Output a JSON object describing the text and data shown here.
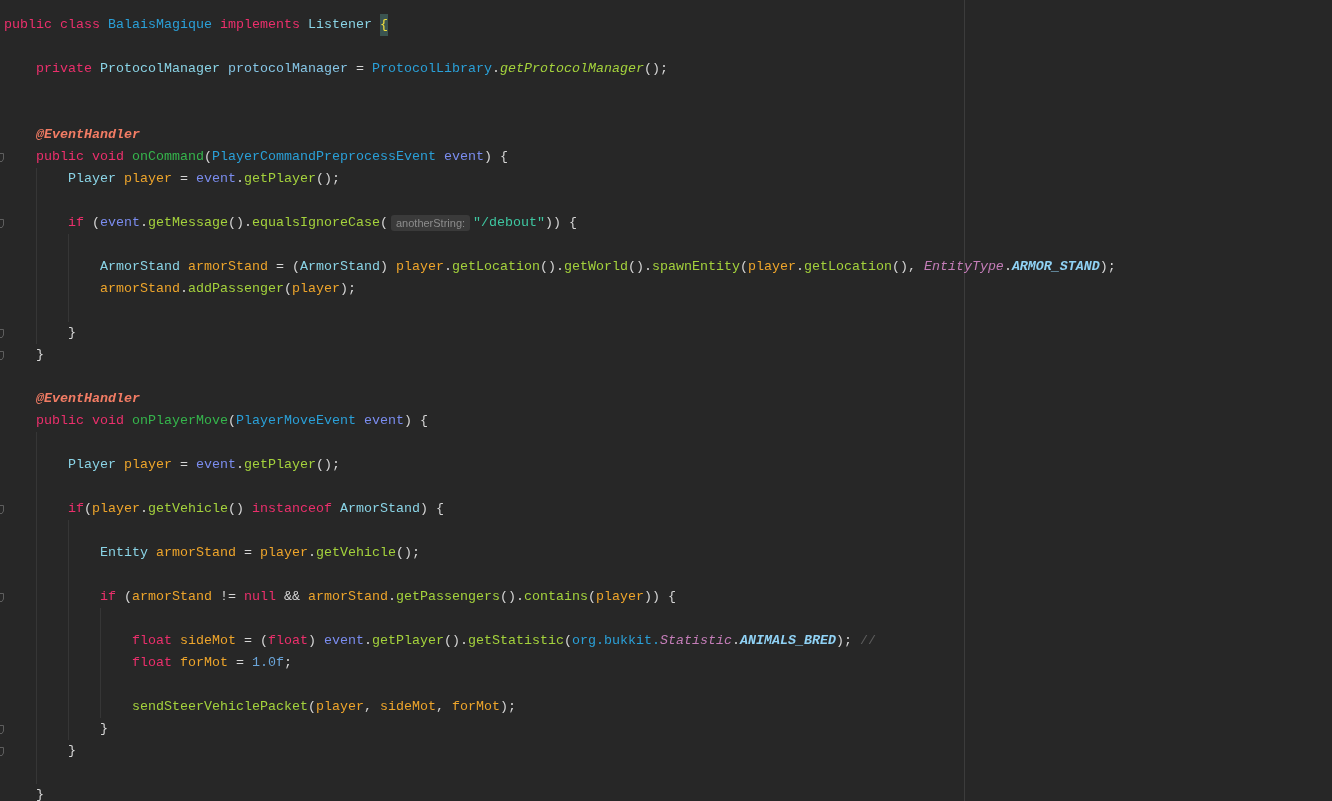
{
  "editor": {
    "lines": [
      {
        "kind": "code",
        "fold": false,
        "tokens": [
          {
            "text": "public ",
            "kind": "keyword"
          },
          {
            "text": "class ",
            "kind": "keyword"
          },
          {
            "text": "BalaisMagique ",
            "kind": "class"
          },
          {
            "text": "implements ",
            "kind": "keyword"
          },
          {
            "text": "Listener ",
            "kind": "type"
          },
          {
            "text": "{",
            "kind": "brace"
          }
        ]
      },
      {
        "kind": "blank",
        "fold": false
      },
      {
        "kind": "code",
        "fold": false,
        "tokens": [
          {
            "text": "    private ",
            "kind": "keyword"
          },
          {
            "text": "ProtocolManager ",
            "kind": "type"
          },
          {
            "text": "protocolManager",
            "kind": "field"
          },
          {
            "text": " = ",
            "kind": "plain"
          },
          {
            "text": "ProtocolLibrary",
            "kind": "class"
          },
          {
            "text": ".",
            "kind": "plain"
          },
          {
            "text": "getProtocolManager",
            "kind": "static"
          },
          {
            "text": "();",
            "kind": "plain"
          }
        ]
      },
      {
        "kind": "blank",
        "fold": false
      },
      {
        "kind": "blank",
        "fold": false
      },
      {
        "kind": "code",
        "fold": false,
        "tokens": [
          {
            "text": "    @EventHandler",
            "kind": "annotation"
          }
        ]
      },
      {
        "kind": "code",
        "fold": true,
        "tokens": [
          {
            "text": "    public ",
            "kind": "keyword"
          },
          {
            "text": "void ",
            "kind": "keyword"
          },
          {
            "text": "onCommand",
            "kind": "declaration"
          },
          {
            "text": "(",
            "kind": "plain"
          },
          {
            "text": "PlayerCommandPreprocessEvent ",
            "kind": "class"
          },
          {
            "text": "event",
            "kind": "parameter"
          },
          {
            "text": ") {",
            "kind": "plain"
          }
        ]
      },
      {
        "kind": "code",
        "fold": false,
        "tokens": [
          {
            "text": "        Player ",
            "kind": "type"
          },
          {
            "text": "player",
            "kind": "local"
          },
          {
            "text": " = ",
            "kind": "plain"
          },
          {
            "text": "event",
            "kind": "parameter"
          },
          {
            "text": ".",
            "kind": "plain"
          },
          {
            "text": "getPlayer",
            "kind": "call"
          },
          {
            "text": "();",
            "kind": "plain"
          }
        ]
      },
      {
        "kind": "blank",
        "fold": false
      },
      {
        "kind": "code",
        "fold": true,
        "tokens": [
          {
            "text": "        if",
            "kind": "keyword"
          },
          {
            "text": " (",
            "kind": "plain"
          },
          {
            "text": "event",
            "kind": "parameter"
          },
          {
            "text": ".",
            "kind": "plain"
          },
          {
            "text": "getMessage",
            "kind": "call"
          },
          {
            "text": "().",
            "kind": "plain"
          },
          {
            "text": "equalsIgnoreCase",
            "kind": "call"
          },
          {
            "text": "(",
            "kind": "plain"
          },
          {
            "text": "anotherString:",
            "kind": "hint"
          },
          {
            "text": "\"/debout\"",
            "kind": "string"
          },
          {
            "text": ")) {",
            "kind": "plain"
          }
        ]
      },
      {
        "kind": "blank",
        "fold": false
      },
      {
        "kind": "code",
        "fold": false,
        "tokens": [
          {
            "text": "            ArmorStand ",
            "kind": "type"
          },
          {
            "text": "armorStand",
            "kind": "local"
          },
          {
            "text": " = (",
            "kind": "plain"
          },
          {
            "text": "ArmorStand",
            "kind": "type"
          },
          {
            "text": ") ",
            "kind": "plain"
          },
          {
            "text": "player",
            "kind": "local"
          },
          {
            "text": ".",
            "kind": "plain"
          },
          {
            "text": "getLocation",
            "kind": "call"
          },
          {
            "text": "().",
            "kind": "plain"
          },
          {
            "text": "getWorld",
            "kind": "call"
          },
          {
            "text": "().",
            "kind": "plain"
          },
          {
            "text": "spawnEntity",
            "kind": "call"
          },
          {
            "text": "(",
            "kind": "plain"
          },
          {
            "text": "player",
            "kind": "local"
          },
          {
            "text": ".",
            "kind": "plain"
          },
          {
            "text": "getLocation",
            "kind": "call"
          },
          {
            "text": "(), ",
            "kind": "plain"
          },
          {
            "text": "EntityType",
            "kind": "enum"
          },
          {
            "text": ".",
            "kind": "plain"
          },
          {
            "text": "ARMOR_STAND",
            "kind": "constant"
          },
          {
            "text": ");",
            "kind": "plain"
          }
        ]
      },
      {
        "kind": "code",
        "fold": false,
        "tokens": [
          {
            "text": "            armorStand",
            "kind": "local"
          },
          {
            "text": ".",
            "kind": "plain"
          },
          {
            "text": "addPassenger",
            "kind": "call"
          },
          {
            "text": "(",
            "kind": "plain"
          },
          {
            "text": "player",
            "kind": "local"
          },
          {
            "text": ");",
            "kind": "plain"
          }
        ]
      },
      {
        "kind": "blank",
        "fold": false
      },
      {
        "kind": "code",
        "fold": true,
        "tokens": [
          {
            "text": "        }",
            "kind": "plain"
          }
        ]
      },
      {
        "kind": "code",
        "fold": true,
        "tokens": [
          {
            "text": "    }",
            "kind": "plain"
          }
        ]
      },
      {
        "kind": "blank",
        "fold": false
      },
      {
        "kind": "code",
        "fold": false,
        "tokens": [
          {
            "text": "    @EventHandler",
            "kind": "annotation"
          }
        ]
      },
      {
        "kind": "code",
        "fold": false,
        "tokens": [
          {
            "text": "    public ",
            "kind": "keyword"
          },
          {
            "text": "void ",
            "kind": "keyword"
          },
          {
            "text": "onPlayerMove",
            "kind": "declaration"
          },
          {
            "text": "(",
            "kind": "plain"
          },
          {
            "text": "PlayerMoveEvent ",
            "kind": "class"
          },
          {
            "text": "event",
            "kind": "parameter"
          },
          {
            "text": ") {",
            "kind": "plain"
          }
        ]
      },
      {
        "kind": "blank",
        "fold": false
      },
      {
        "kind": "code",
        "fold": false,
        "tokens": [
          {
            "text": "        Player ",
            "kind": "type"
          },
          {
            "text": "player",
            "kind": "local"
          },
          {
            "text": " = ",
            "kind": "plain"
          },
          {
            "text": "event",
            "kind": "parameter"
          },
          {
            "text": ".",
            "kind": "plain"
          },
          {
            "text": "getPlayer",
            "kind": "call"
          },
          {
            "text": "();",
            "kind": "plain"
          }
        ]
      },
      {
        "kind": "blank",
        "fold": false
      },
      {
        "kind": "code",
        "fold": true,
        "tokens": [
          {
            "text": "        if",
            "kind": "keyword"
          },
          {
            "text": "(",
            "kind": "plain"
          },
          {
            "text": "player",
            "kind": "local"
          },
          {
            "text": ".",
            "kind": "plain"
          },
          {
            "text": "getVehicle",
            "kind": "call"
          },
          {
            "text": "() ",
            "kind": "plain"
          },
          {
            "text": "instanceof ",
            "kind": "keyword"
          },
          {
            "text": "ArmorStand",
            "kind": "type"
          },
          {
            "text": ") {",
            "kind": "plain"
          }
        ]
      },
      {
        "kind": "blank",
        "fold": false
      },
      {
        "kind": "code",
        "fold": false,
        "tokens": [
          {
            "text": "            Entity ",
            "kind": "type"
          },
          {
            "text": "armorStand",
            "kind": "local"
          },
          {
            "text": " = ",
            "kind": "plain"
          },
          {
            "text": "player",
            "kind": "local"
          },
          {
            "text": ".",
            "kind": "plain"
          },
          {
            "text": "getVehicle",
            "kind": "call"
          },
          {
            "text": "();",
            "kind": "plain"
          }
        ]
      },
      {
        "kind": "blank",
        "fold": false
      },
      {
        "kind": "code",
        "fold": true,
        "tokens": [
          {
            "text": "            if",
            "kind": "keyword"
          },
          {
            "text": " (",
            "kind": "plain"
          },
          {
            "text": "armorStand",
            "kind": "local"
          },
          {
            "text": " != ",
            "kind": "plain"
          },
          {
            "text": "null",
            "kind": "keyword"
          },
          {
            "text": " && ",
            "kind": "plain"
          },
          {
            "text": "armorStand",
            "kind": "local"
          },
          {
            "text": ".",
            "kind": "plain"
          },
          {
            "text": "getPassengers",
            "kind": "call"
          },
          {
            "text": "().",
            "kind": "plain"
          },
          {
            "text": "contains",
            "kind": "call"
          },
          {
            "text": "(",
            "kind": "plain"
          },
          {
            "text": "player",
            "kind": "local"
          },
          {
            "text": ")) {",
            "kind": "plain"
          }
        ]
      },
      {
        "kind": "blank",
        "fold": false
      },
      {
        "kind": "code",
        "fold": false,
        "tokens": [
          {
            "text": "                float ",
            "kind": "keyword"
          },
          {
            "text": "sideMot",
            "kind": "local"
          },
          {
            "text": " = (",
            "kind": "plain"
          },
          {
            "text": "float",
            "kind": "keyword"
          },
          {
            "text": ") ",
            "kind": "plain"
          },
          {
            "text": "event",
            "kind": "parameter"
          },
          {
            "text": ".",
            "kind": "plain"
          },
          {
            "text": "getPlayer",
            "kind": "call"
          },
          {
            "text": "().",
            "kind": "plain"
          },
          {
            "text": "getStatistic",
            "kind": "call"
          },
          {
            "text": "(",
            "kind": "plain"
          },
          {
            "text": "org.bukkit.",
            "kind": "class"
          },
          {
            "text": "Statistic",
            "kind": "enum"
          },
          {
            "text": ".",
            "kind": "plain"
          },
          {
            "text": "ANIMALS_BRED",
            "kind": "constant"
          },
          {
            "text": "); ",
            "kind": "plain"
          },
          {
            "text": "//",
            "kind": "comment"
          }
        ]
      },
      {
        "kind": "code",
        "fold": false,
        "tokens": [
          {
            "text": "                float ",
            "kind": "keyword"
          },
          {
            "text": "forMot",
            "kind": "local"
          },
          {
            "text": " = ",
            "kind": "plain"
          },
          {
            "text": "1.0f",
            "kind": "number"
          },
          {
            "text": ";",
            "kind": "plain"
          }
        ]
      },
      {
        "kind": "blank",
        "fold": false
      },
      {
        "kind": "code",
        "fold": false,
        "tokens": [
          {
            "text": "                sendSteerVehiclePacket",
            "kind": "call"
          },
          {
            "text": "(",
            "kind": "plain"
          },
          {
            "text": "player",
            "kind": "local"
          },
          {
            "text": ", ",
            "kind": "plain"
          },
          {
            "text": "sideMot",
            "kind": "local"
          },
          {
            "text": ", ",
            "kind": "plain"
          },
          {
            "text": "forMot",
            "kind": "local"
          },
          {
            "text": ");",
            "kind": "plain"
          }
        ]
      },
      {
        "kind": "code",
        "fold": true,
        "tokens": [
          {
            "text": "            }",
            "kind": "plain"
          }
        ]
      },
      {
        "kind": "code",
        "fold": true,
        "tokens": [
          {
            "text": "        }",
            "kind": "plain"
          }
        ]
      },
      {
        "kind": "blank",
        "fold": false
      },
      {
        "kind": "code",
        "fold": false,
        "tokens": [
          {
            "text": "    }",
            "kind": "plain"
          }
        ]
      }
    ]
  }
}
